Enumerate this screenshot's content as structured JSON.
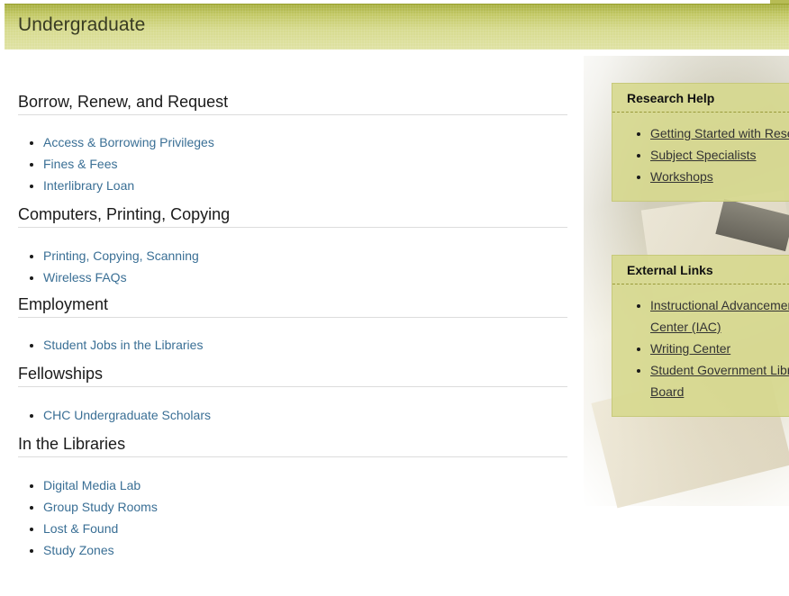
{
  "page": {
    "title": "Undergraduate"
  },
  "sections": [
    {
      "heading": "Borrow, Renew, and Request",
      "links": [
        "Access & Borrowing Privileges",
        "Fines & Fees",
        "Interlibrary Loan"
      ]
    },
    {
      "heading": "Computers, Printing, Copying",
      "links": [
        "Printing, Copying, Scanning",
        "Wireless FAQs"
      ]
    },
    {
      "heading": "Employment",
      "links": [
        "Student Jobs in the Libraries"
      ]
    },
    {
      "heading": "Fellowships",
      "links": [
        "CHC Undergraduate Scholars"
      ]
    },
    {
      "heading": "In the Libraries",
      "links": [
        "Digital Media Lab",
        "Group Study Rooms",
        "Lost & Found",
        "Study Zones"
      ]
    }
  ],
  "sidebar": {
    "research_help": {
      "title": "Research Help",
      "links": [
        "Getting Started with Research",
        "Subject Specialists",
        "Workshops"
      ]
    },
    "external_links": {
      "title": "External Links",
      "links": [
        "Instructional Advancement Center (IAC)",
        "Writing Center",
        "Student Government Library Board"
      ]
    }
  },
  "colors": {
    "link": "#3a6f95",
    "banner": "#c2c864",
    "sidebar_box": "#d6d88c"
  }
}
